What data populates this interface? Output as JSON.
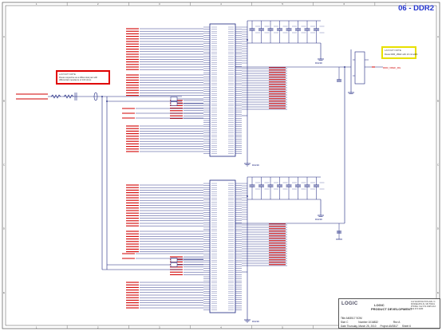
{
  "sheet": {
    "title": "06 - DDR2",
    "frame_numbers": [
      "1",
      "2",
      "3",
      "4",
      "5",
      "6",
      "7"
    ],
    "frame_letters": [
      "A",
      "B",
      "C",
      "D",
      "E"
    ]
  },
  "notes": {
    "routing": {
      "heading": "LAYOUT NOTE",
      "body_line1": "Route respective as a differential pair with",
      "body_line2": "differential impedance of 100 ohms"
    },
    "power": {
      "heading": "LAYOUT NOTE",
      "body": "Route DDR_VREF with 10 mil width"
    }
  },
  "labels": {
    "ground": "DGND",
    "vref_net": "DDR_VREF_RG"
  },
  "title_block": {
    "logo": "LOGIC",
    "company_line1": "LOGIC",
    "company_line2": "PRODUCT DEVELOPMENT",
    "address": "411 WASHINGTON AVE. N. MINNEAPOLIS, MN 55401 PHONE: 612.672.9495 FAX: 612.672.9489",
    "title_label": "Title",
    "title_value": "AM3517 SOM",
    "size_label": "Size",
    "size_value": "C",
    "number_label": "Number",
    "number_value": "1016832",
    "rev_label": "Rev",
    "rev_value": "A",
    "date_label": "Date",
    "date_value": "Thursday, March 25, 2010",
    "project_label": "Project",
    "project_value": "AM3517",
    "sheet_label": "Sheet",
    "sheet_value": "6"
  },
  "colors": {
    "wire": "#1a237e",
    "net_label": "#d00000",
    "component": "#1a237e",
    "title": "#2233cc",
    "note_red": "#e00000",
    "note_yellow": "#e8e000"
  }
}
